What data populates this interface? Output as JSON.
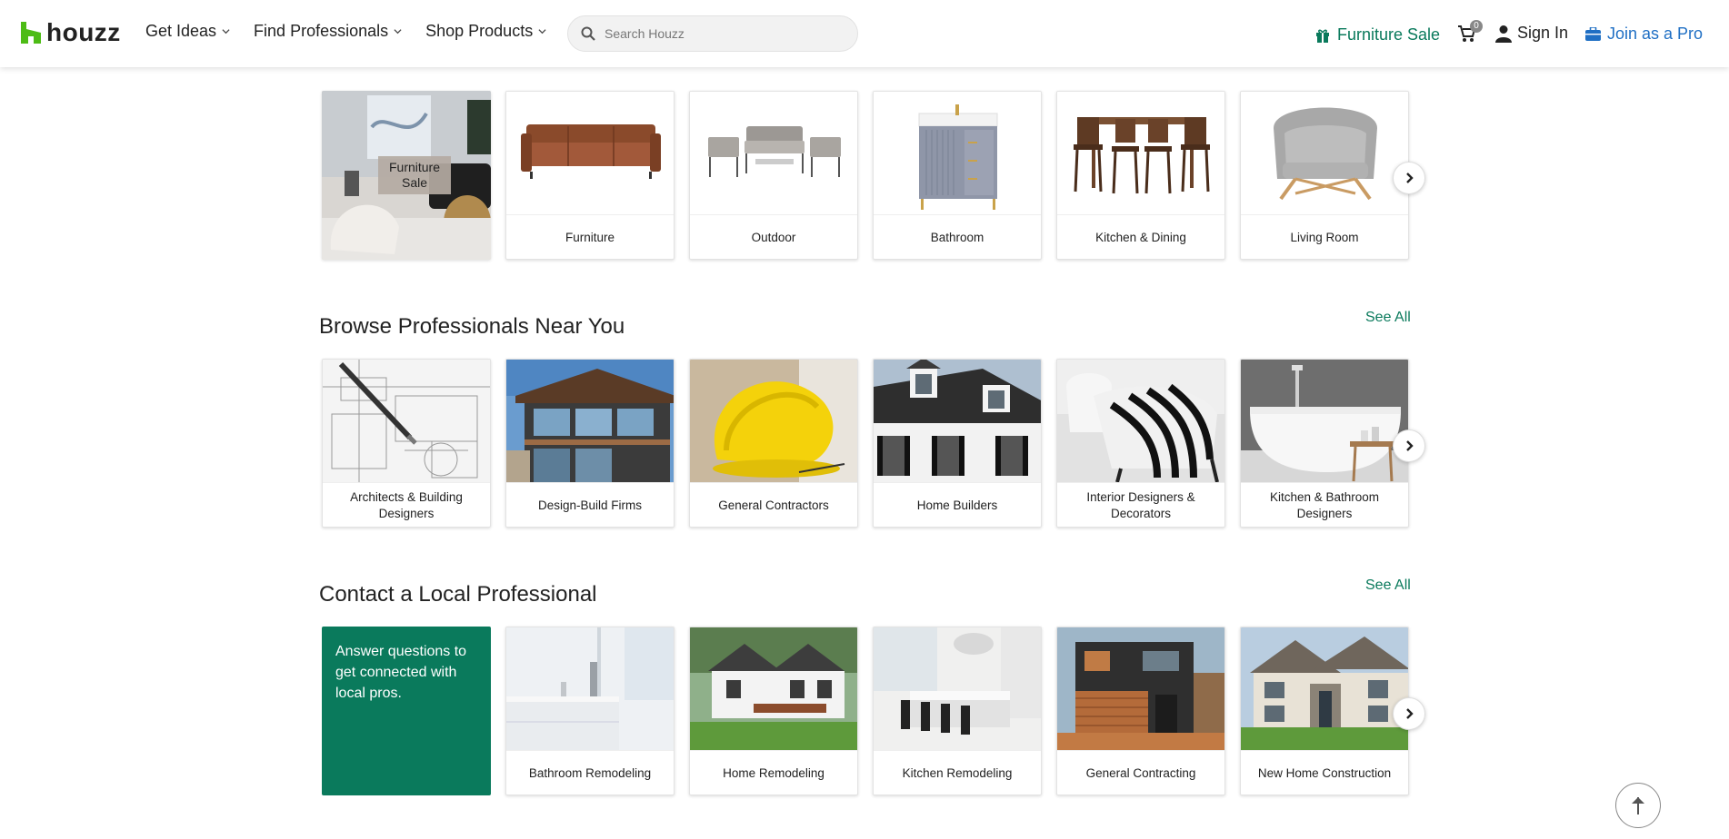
{
  "header": {
    "logo_text": "houzz",
    "nav": [
      {
        "label": "Get Ideas"
      },
      {
        "label": "Find Professionals"
      },
      {
        "label": "Shop Products"
      }
    ],
    "search_placeholder": "Search Houzz",
    "sale_label": "Furniture Sale",
    "cart_count": "0",
    "signin_label": "Sign In",
    "join_label": "Join as a Pro"
  },
  "shop": {
    "sale_card_label": "Furniture Sale",
    "categories": [
      {
        "label": "Furniture"
      },
      {
        "label": "Outdoor"
      },
      {
        "label": "Bathroom"
      },
      {
        "label": "Kitchen & Dining"
      },
      {
        "label": "Living Room"
      }
    ]
  },
  "browse": {
    "title": "Browse Professionals Near You",
    "see_all": "See All",
    "cards": [
      {
        "label": "Architects & Building Designers"
      },
      {
        "label": "Design-Build Firms"
      },
      {
        "label": "General Contractors"
      },
      {
        "label": "Home Builders"
      },
      {
        "label": "Interior Designers & Decorators"
      },
      {
        "label": "Kitchen & Bathroom Designers"
      }
    ]
  },
  "contact": {
    "title": "Contact a Local Professional",
    "see_all": "See All",
    "intro": "Answer questions to get connected with local pros.",
    "cards": [
      {
        "label": "Bathroom Remodeling"
      },
      {
        "label": "Home Remodeling"
      },
      {
        "label": "Kitchen Remodeling"
      },
      {
        "label": "General Contracting"
      },
      {
        "label": "New Home Construction"
      }
    ]
  },
  "colors": {
    "brand_green": "#0a7a5c",
    "join_blue": "#1f6fc4",
    "logo_green": "#4dbc15"
  }
}
